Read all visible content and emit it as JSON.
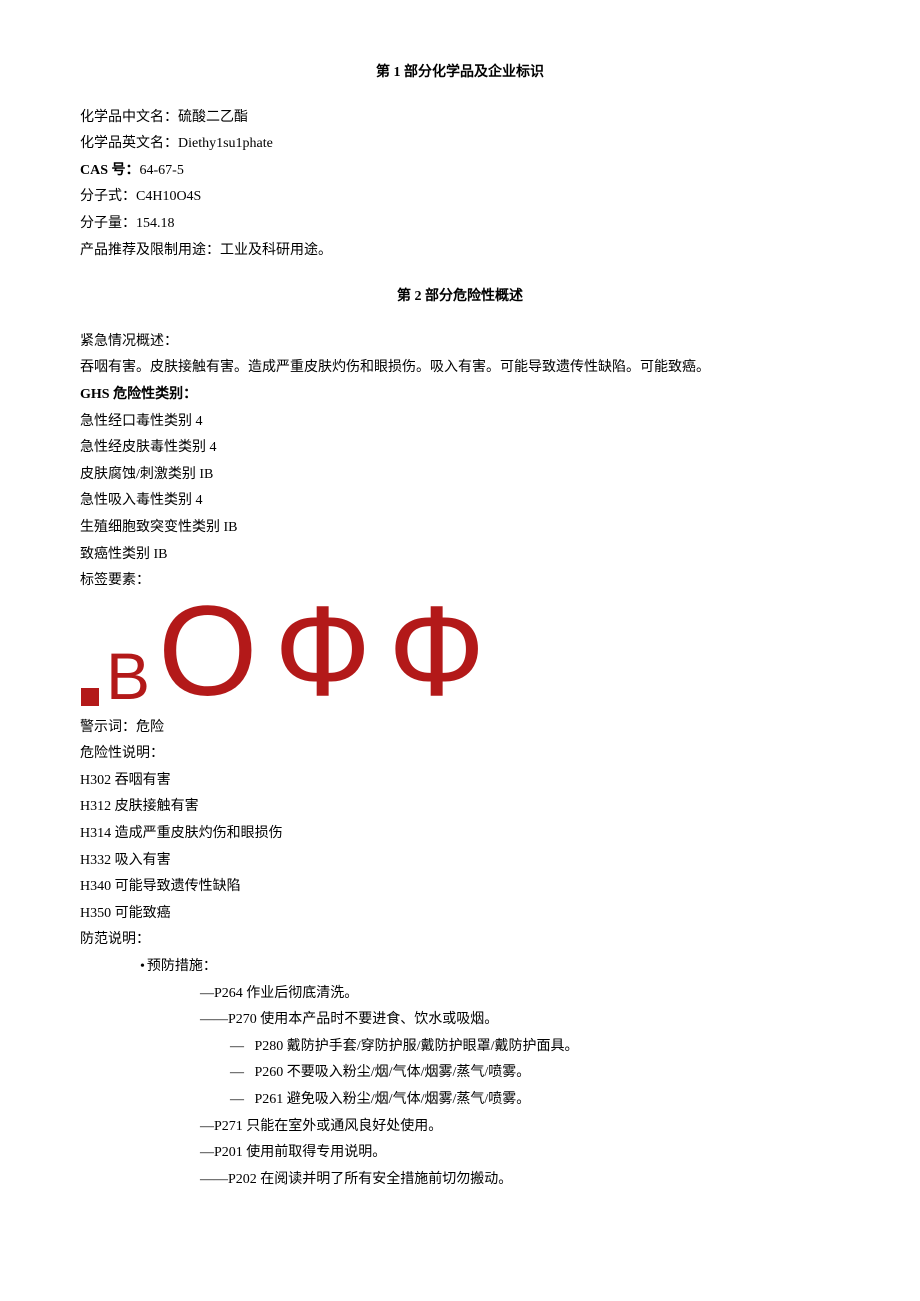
{
  "section1": {
    "heading_prefix": "第 ",
    "heading_num": "1",
    "heading_suffix": " 部分化学品及企业标识",
    "rows": {
      "name_cn_lab": "化学品中文名：",
      "name_cn_val": "硫酸二乙酯",
      "name_en_lab": "化学品英文名：",
      "name_en_val": "Diethy1su1phate",
      "cas_lab": "CAS 号：",
      "cas_val": "64-67-5",
      "formula_lab": "分子式：",
      "formula_val": "C4H10O4S",
      "mw_lab": "分子量：",
      "mw_val": "154.18",
      "use_lab": "产品推荐及限制用途：",
      "use_val": "工业及科研用途。"
    }
  },
  "section2": {
    "heading_prefix": "第 ",
    "heading_num": "2",
    "heading_suffix": " 部分危险性概述",
    "emergency_lab": "紧急情况概述：",
    "emergency_text": "吞咽有害。皮肤接触有害。造成严重皮肤灼伤和眼损伤。吸入有害。可能导致遗传性缺陷。可能致癌。",
    "ghs_lab": "GHS 危险性类别：",
    "ghs_items": [
      "急性经口毒性类别 4",
      "急性经皮肤毒性类别 4",
      "皮肤腐蚀/刺激类别 IB",
      "急性吸入毒性类别 4",
      "生殖细胞致突变性类别 IB",
      "致癌性类别 IB"
    ],
    "label_elements_lab": "标签要素：",
    "pictograms": {
      "square": {
        "color": "#b31919",
        "size": 20
      },
      "letter_b": {
        "text": "Β",
        "color": "#b31919"
      },
      "circle": {
        "text": "О",
        "color": "#b31919"
      },
      "phi1": {
        "text": "Ф",
        "color": "#b31919"
      },
      "phi2": {
        "text": "Ф",
        "color": "#b31919"
      }
    },
    "signal_word_lab": "警示词：",
    "signal_word_val": "危险",
    "hazard_lab": "危险性说明：",
    "hazard_items": [
      "H302 吞咽有害",
      "H312 皮肤接触有害",
      "H314 造成严重皮肤灼伤和眼损伤",
      "H332 吸入有害",
      "H340 可能导致遗传性缺陷",
      "H350 可能致癌"
    ],
    "precaution_lab": "防范说明：",
    "prevention_lab": "预防措施：",
    "prevention_items": [
      {
        "style": "dash-short",
        "text": "P264 作业后彻底清洗。"
      },
      {
        "style": "dash-long",
        "text": "P270 使用本产品时不要进食、饮水或吸烟。"
      },
      {
        "style": "dash-spaced",
        "text": "P280 戴防护手套/穿防护服/戴防护眼罩/戴防护面具。"
      },
      {
        "style": "dash-spaced",
        "text": "P260 不要吸入粉尘/烟/气体/烟雾/蒸气/喷雾。"
      },
      {
        "style": "dash-spaced",
        "text": "P261 避免吸入粉尘/烟/气体/烟雾/蒸气/喷雾。"
      },
      {
        "style": "dash-short",
        "text": "P271 只能在室外或通风良好处使用。"
      },
      {
        "style": "dash-short",
        "text": "P201 使用前取得专用说明。"
      },
      {
        "style": "dash-long",
        "text": "P202 在阅读并明了所有安全措施前切勿搬动。"
      }
    ]
  }
}
